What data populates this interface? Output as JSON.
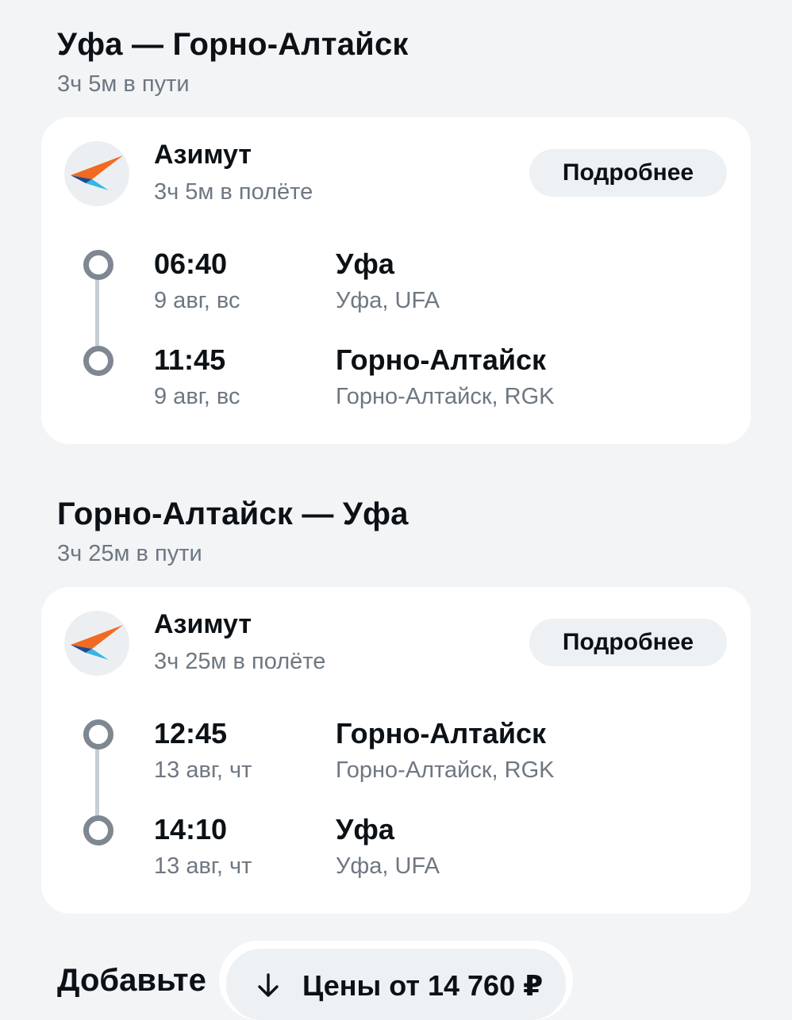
{
  "segments": [
    {
      "route_title": "Уфа — Горно-Алтайск",
      "total_duration": "3ч 5м в пути",
      "airline": "Азимут",
      "flight_duration": "3ч 5м в полёте",
      "details_label": "Подробнее",
      "departure": {
        "time": "06:40",
        "date": "9 авг, вс",
        "city": "Уфа",
        "airport": "Уфа, UFA"
      },
      "arrival": {
        "time": "11:45",
        "date": "9 авг, вс",
        "city": "Горно-Алтайск",
        "airport": "Горно-Алтайск, RGK"
      }
    },
    {
      "route_title": "Горно-Алтайск — Уфа",
      "total_duration": "3ч 25м в пути",
      "airline": "Азимут",
      "flight_duration": "3ч 25м в полёте",
      "details_label": "Подробнее",
      "departure": {
        "time": "12:45",
        "date": "13 авг, чт",
        "city": "Горно-Алтайск",
        "airport": "Горно-Алтайск, RGK"
      },
      "arrival": {
        "time": "14:10",
        "date": "13 авг, чт",
        "city": "Уфа",
        "airport": "Уфа, UFA"
      }
    }
  ],
  "add_section_title": "Добавьте",
  "price_button": {
    "icon": "arrow-down-icon",
    "label": "Цены от 14 760 ₽"
  },
  "colors": {
    "background": "#f2f4f6",
    "card": "#ffffff",
    "text_primary": "#0c1116",
    "text_secondary": "#6e7781",
    "timeline": "#7f8891",
    "logo_orange": "#f26a21",
    "logo_blue": "#1e4b8f",
    "logo_cyan": "#35b5e5"
  }
}
